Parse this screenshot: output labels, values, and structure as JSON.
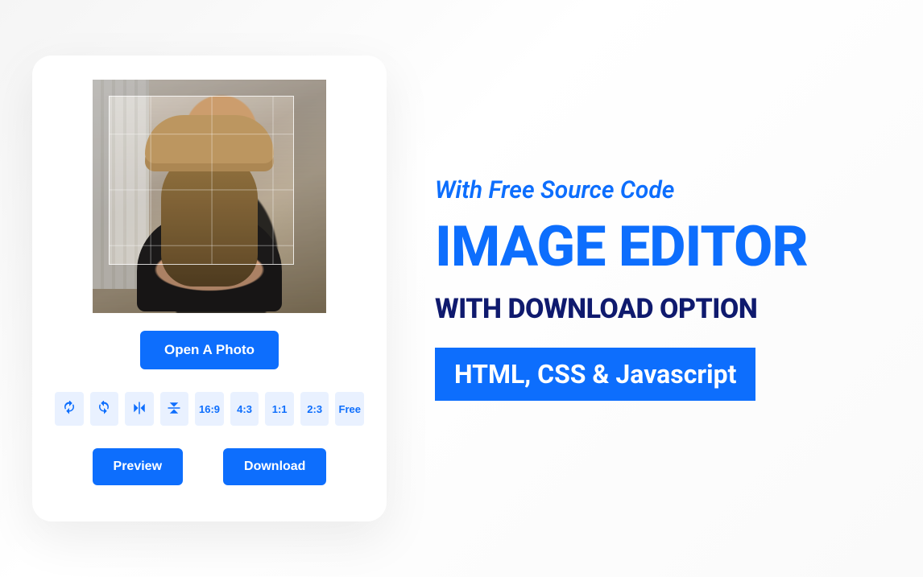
{
  "editor": {
    "open_button": "Open A Photo",
    "toolbar": {
      "rotate_left": "rotate-left",
      "rotate_right": "rotate-right",
      "flip_h": "flip-horizontal",
      "flip_v": "flip-vertical",
      "ratios": [
        "16:9",
        "4:3",
        "1:1",
        "2:3",
        "Free"
      ]
    },
    "preview_button": "Preview",
    "download_button": "Download"
  },
  "promo": {
    "kicker": "With Free Source Code",
    "title": "IMAGE EDITOR",
    "subtitle": "WITH DOWNLOAD OPTION",
    "tag": "HTML, CSS & Javascript"
  },
  "colors": {
    "primary": "#0d6efd",
    "primary_light": "#e9f1ff",
    "dark_blue": "#0f1a6e"
  }
}
